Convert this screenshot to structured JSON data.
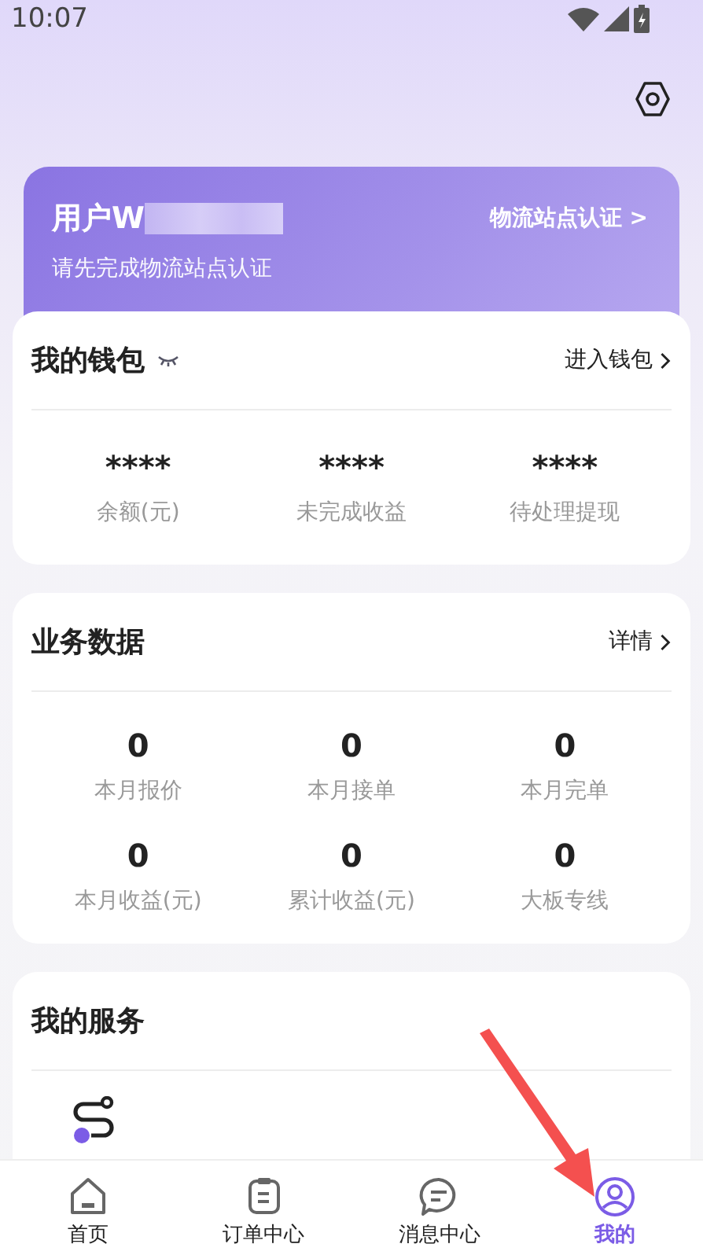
{
  "status_bar": {
    "time": "10:07"
  },
  "profile": {
    "name": "用户W",
    "name_redacted": true,
    "hint": "请先完成物流站点认证",
    "action": "物流站点认证 >"
  },
  "wallet": {
    "title": "我的钱包",
    "hidden": true,
    "link": "进入钱包",
    "stats": [
      {
        "value": "****",
        "label": "余额(元)"
      },
      {
        "value": "****",
        "label": "未完成收益"
      },
      {
        "value": "****",
        "label": "待处理提现"
      }
    ]
  },
  "business": {
    "title": "业务数据",
    "link": "详情",
    "stats": [
      {
        "value": "0",
        "label": "本月报价"
      },
      {
        "value": "0",
        "label": "本月接单"
      },
      {
        "value": "0",
        "label": "本月完单"
      },
      {
        "value": "0",
        "label": "本月收益(元)"
      },
      {
        "value": "0",
        "label": "累计收益(元)"
      },
      {
        "value": "0",
        "label": "大板专线"
      }
    ]
  },
  "services": {
    "title": "我的服务"
  },
  "tabs": [
    {
      "kind": "home",
      "label": "首页",
      "selected": false
    },
    {
      "kind": "orders",
      "label": "订单中心",
      "selected": false
    },
    {
      "kind": "messages",
      "label": "消息中心",
      "selected": false
    },
    {
      "kind": "profile",
      "label": "我的",
      "selected": true
    }
  ]
}
